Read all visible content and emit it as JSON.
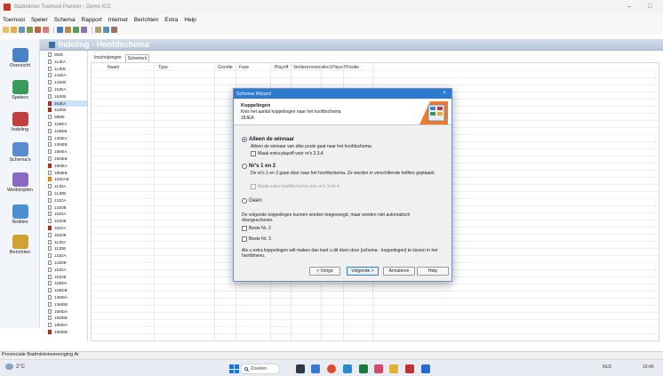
{
  "window": {
    "title": "Badminton Toernooi Planner - Demo ICC",
    "controls": [
      "–",
      "□"
    ]
  },
  "menu": [
    "Toernooi",
    "Speler",
    "Schema",
    "Rapport",
    "Internet",
    "Berichten",
    "Extra",
    "Help"
  ],
  "nav": [
    {
      "label": "Overzicht"
    },
    {
      "label": "Spelers"
    },
    {
      "label": "Indeling"
    },
    {
      "label": "Schema's"
    },
    {
      "label": "Wedstrijden"
    },
    {
      "label": "Notities"
    },
    {
      "label": "Berichten"
    }
  ],
  "header": {
    "title": "Indeling - Hoofdschema"
  },
  "tree": [
    {
      "label": "09JE",
      "icon": "doc"
    },
    {
      "label": "11JEA",
      "icon": "doc"
    },
    {
      "label": "11JEB",
      "icon": "doc"
    },
    {
      "label": "13JEA",
      "icon": "doc"
    },
    {
      "label": "13JEB",
      "icon": "doc"
    },
    {
      "label": "15JEA",
      "icon": "doc"
    },
    {
      "label": "15JEB",
      "icon": "doc"
    },
    {
      "label": "16JEA",
      "icon": "red",
      "selected": true
    },
    {
      "label": "16JEB",
      "icon": "red"
    },
    {
      "label": "09ME",
      "icon": "doc"
    },
    {
      "label": "11MEA",
      "icon": "doc"
    },
    {
      "label": "11MEB",
      "icon": "doc"
    },
    {
      "label": "13MEA",
      "icon": "doc"
    },
    {
      "label": "13MEB",
      "icon": "doc"
    },
    {
      "label": "15MEA",
      "icon": "doc"
    },
    {
      "label": "15MEB",
      "icon": "doc"
    },
    {
      "label": "18MEA",
      "icon": "red"
    },
    {
      "label": "18MEB",
      "icon": "doc"
    },
    {
      "label": "18JDAB",
      "icon": "orange"
    },
    {
      "label": "11JDA",
      "icon": "doc"
    },
    {
      "label": "11JDB",
      "icon": "doc"
    },
    {
      "label": "13JDA",
      "icon": "doc"
    },
    {
      "label": "13JDB",
      "icon": "doc"
    },
    {
      "label": "15JDA",
      "icon": "doc"
    },
    {
      "label": "15JDB",
      "icon": "doc"
    },
    {
      "label": "18JDA",
      "icon": "red"
    },
    {
      "label": "18JDB",
      "icon": "doc"
    },
    {
      "label": "11JDA",
      "icon": "doc"
    },
    {
      "label": "11JDB",
      "icon": "doc"
    },
    {
      "label": "13JDA",
      "icon": "doc"
    },
    {
      "label": "13JDB",
      "icon": "doc"
    },
    {
      "label": "15JDA",
      "icon": "doc"
    },
    {
      "label": "15JDB",
      "icon": "doc"
    },
    {
      "label": "11MDA",
      "icon": "doc"
    },
    {
      "label": "11MDB",
      "icon": "doc"
    },
    {
      "label": "13MDA",
      "icon": "doc"
    },
    {
      "label": "13MDB",
      "icon": "doc"
    },
    {
      "label": "15MDA",
      "icon": "doc"
    },
    {
      "label": "15MDB",
      "icon": "doc"
    },
    {
      "label": "18MDA",
      "icon": "doc"
    },
    {
      "label": "18MDB",
      "icon": "red"
    }
  ],
  "tabs": [
    {
      "label": "Inschrijvingen",
      "active": false
    },
    {
      "label": "Schema's",
      "active": true
    }
  ],
  "columns": [
    "Naam",
    "Type",
    "Grootte",
    "Fase",
    "Playoff",
    "Verliezersronde",
    "Incl.Playoff",
    "Positie"
  ],
  "statusbar": {
    "text": "Provinciale Badmintonvereniging Ar"
  },
  "taskbar": {
    "weather": "2°C",
    "search": "Zoeken",
    "tray_lang": "NLD",
    "tray_time": "16:40"
  },
  "dialog": {
    "title": "Schema Wizard",
    "close": "×",
    "banner": {
      "title": "Koppelingen",
      "description": "Kies het aantal koppelingen naar het hoofdschema",
      "subtitle": "18JEA"
    },
    "option1": {
      "label": "Alleen de winnaar",
      "description": "Alleen de winnaar van elke poule gaat naar het hoofdschema.",
      "checkbox": "Maak extra playoff voor nr's 2,3,4",
      "selected": true
    },
    "option2": {
      "label": "Nr's 1 en 2",
      "description": "De nr's 1 en 2 gaan door naar het hoofdschema. Ze worden in verschillende helften geplaatst.",
      "checkbox": "Maak extra hoofdschema voor nr's 3 en 4",
      "selected": false
    },
    "option3": {
      "label": "Geen",
      "selected": false
    },
    "extra_text": "De volgende koppelingen kunnen worden toegevoegd, maar worden niet automatisch doorgeschoven.",
    "extra_check1": "Beste Nr. 2",
    "extra_check2": "Beste Nr. 3",
    "footer_text": "Als u extra koppelingen wilt maken dan kunt u dit doen door [schema - koppelingen] te kiezen in het hoofdmenu.",
    "buttons": {
      "back": "< Vorige",
      "next": "Volgende >",
      "cancel": "Annuleren",
      "help": "Help"
    }
  },
  "colors": {
    "dialog_title": "#2c7bd1",
    "header": "#b9c8da",
    "selected_item": "#cce0f7"
  }
}
